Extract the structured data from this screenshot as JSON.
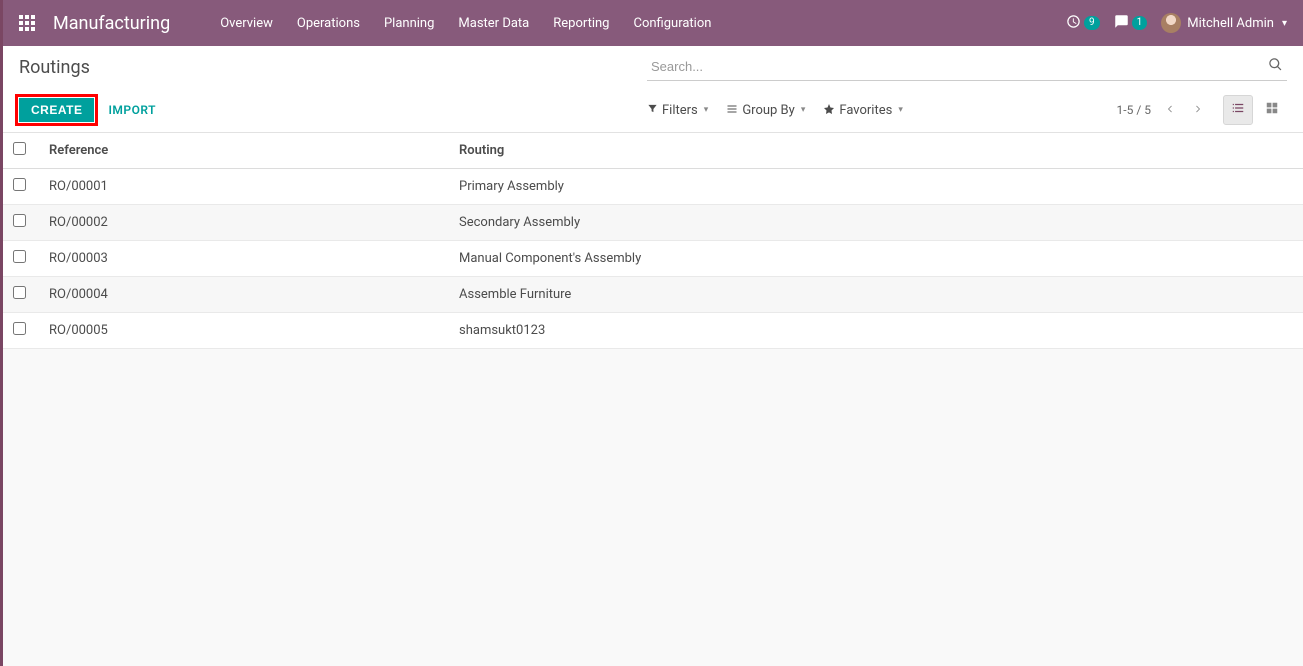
{
  "header": {
    "app_name": "Manufacturing",
    "menu": [
      "Overview",
      "Operations",
      "Planning",
      "Master Data",
      "Reporting",
      "Configuration"
    ],
    "activity_count": "9",
    "chat_count": "1",
    "user_name": "Mitchell Admin"
  },
  "control": {
    "page_title": "Routings",
    "create_label": "CREATE",
    "import_label": "IMPORT",
    "search_placeholder": "Search...",
    "filters_label": "Filters",
    "groupby_label": "Group By",
    "favorites_label": "Favorites",
    "pager_text": "1-5 / 5"
  },
  "table": {
    "columns": {
      "reference": "Reference",
      "routing": "Routing"
    },
    "rows": [
      {
        "reference": "RO/00001",
        "routing": "Primary Assembly"
      },
      {
        "reference": "RO/00002",
        "routing": "Secondary Assembly"
      },
      {
        "reference": "RO/00003",
        "routing": "Manual Component's Assembly"
      },
      {
        "reference": "RO/00004",
        "routing": "Assemble Furniture"
      },
      {
        "reference": "RO/00005",
        "routing": "shamsukt0123"
      }
    ]
  }
}
